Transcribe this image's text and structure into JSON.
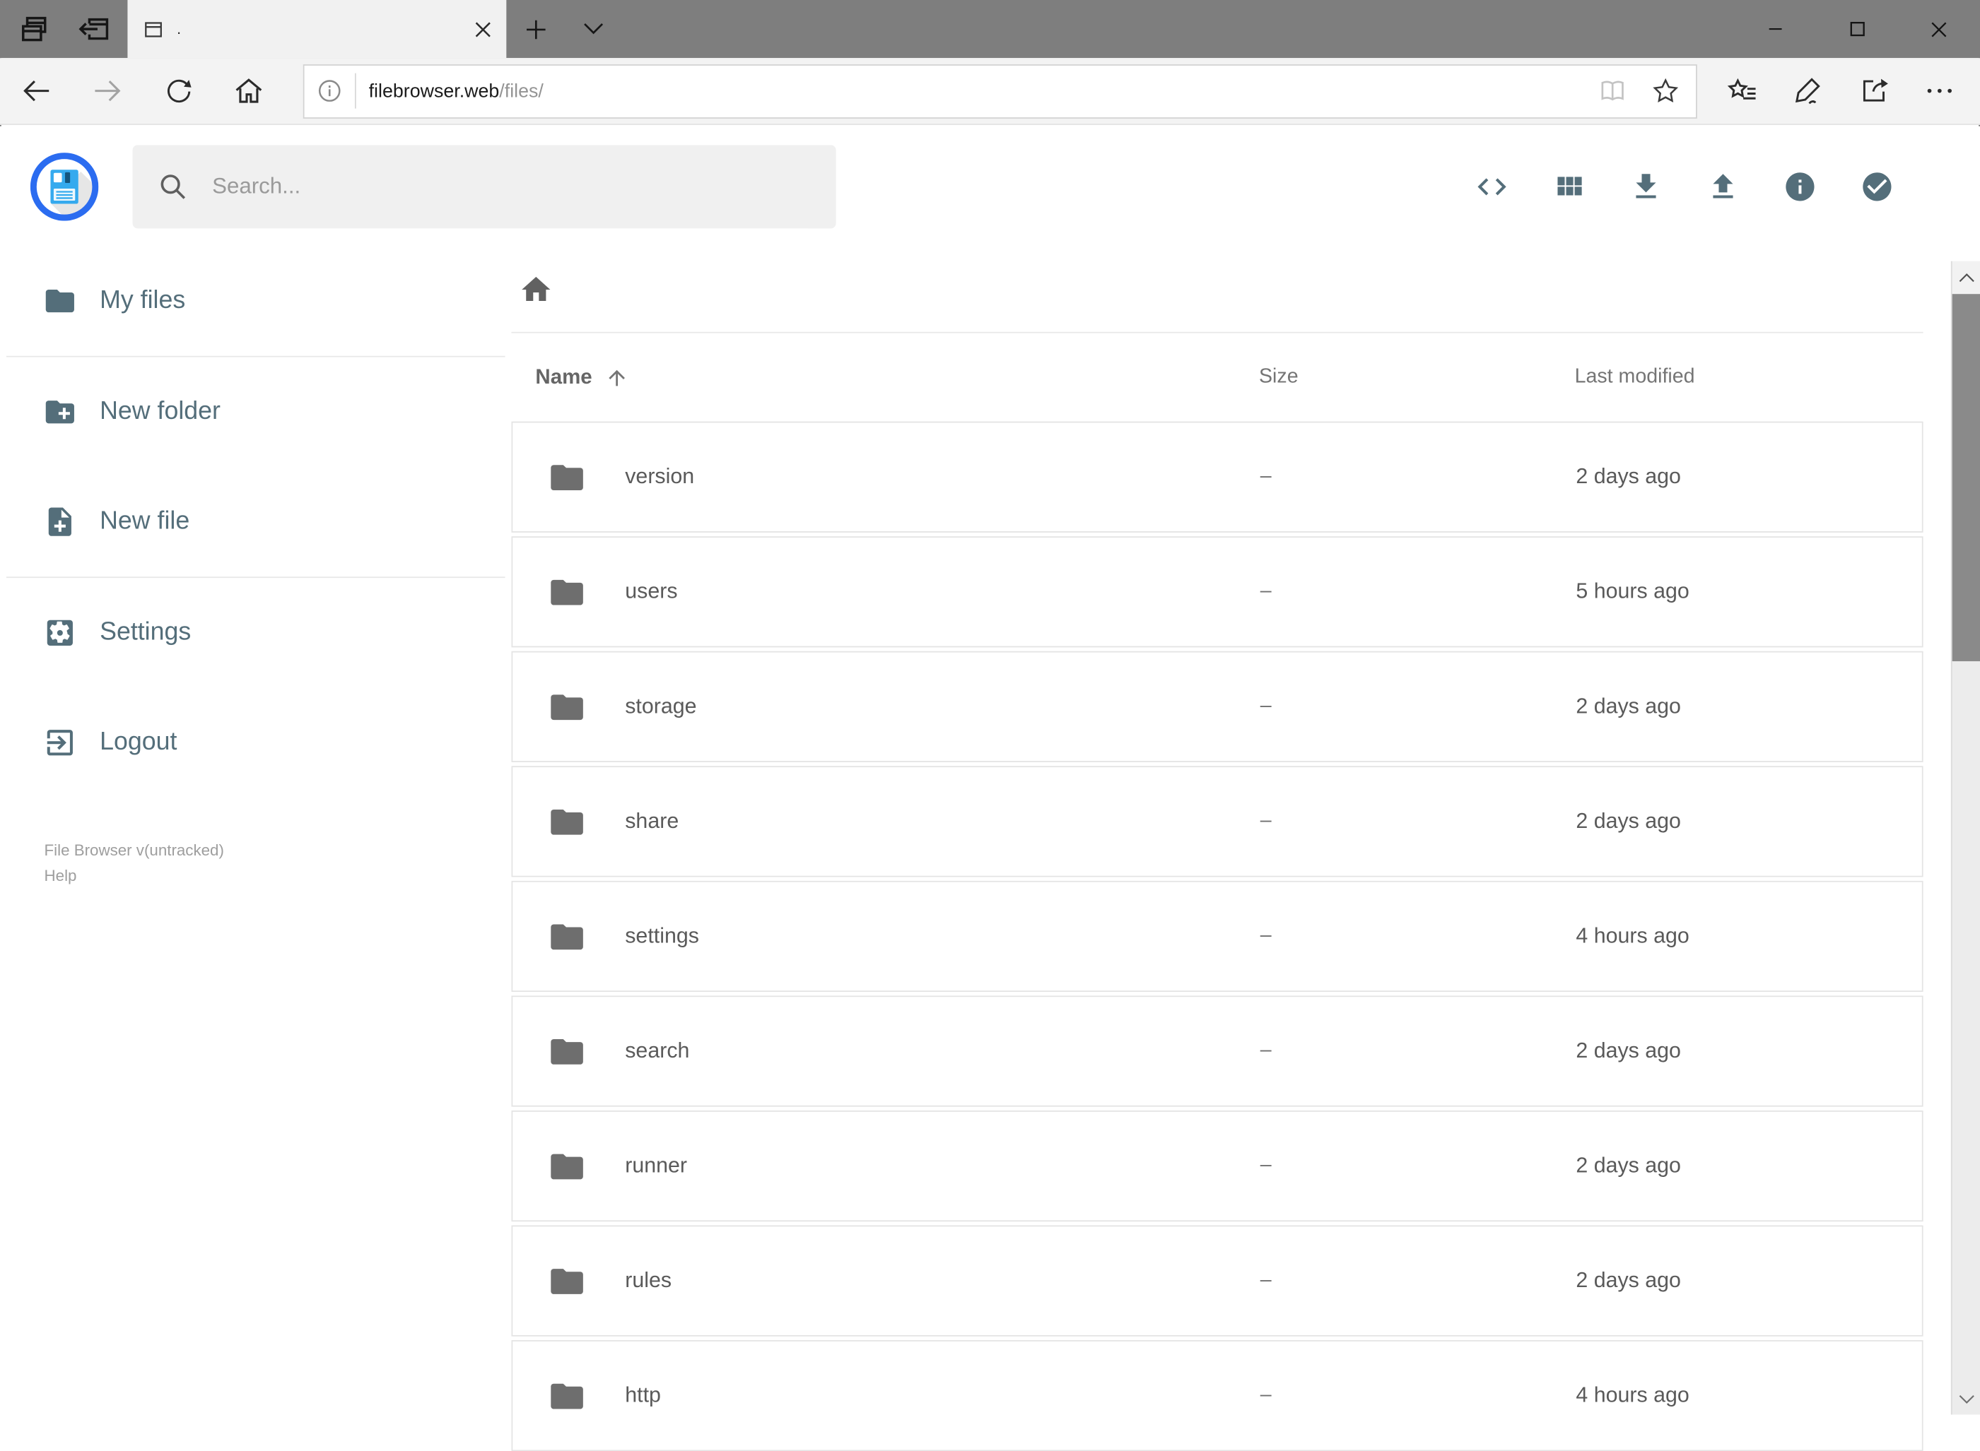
{
  "browser": {
    "tabbar": {
      "tab_title": ".",
      "left_icons": [
        "tab-preview",
        "set-tabs-aside"
      ],
      "window_controls": [
        "minimize",
        "maximize",
        "close"
      ]
    },
    "navbar": {
      "url_domain": "filebrowser.web",
      "url_path": "/files/",
      "icons": [
        "back",
        "forward",
        "refresh",
        "home",
        "site-info",
        "reading-view",
        "favorite-star",
        "hub",
        "web-notes",
        "share",
        "more"
      ]
    }
  },
  "app": {
    "header": {
      "search_placeholder": "Search...",
      "action_icons": [
        "code",
        "grid-view",
        "download",
        "upload",
        "info",
        "select-multiple"
      ]
    },
    "sidebar": {
      "items": [
        {
          "label": "My files",
          "icon": "folder"
        },
        {
          "label": "New folder",
          "icon": "folder-plus"
        },
        {
          "label": "New file",
          "icon": "file-plus"
        },
        {
          "label": "Settings",
          "icon": "settings-gear"
        },
        {
          "label": "Logout",
          "icon": "logout"
        }
      ],
      "footer": {
        "version": "File Browser v(untracked)",
        "help_label": "Help"
      }
    },
    "listing": {
      "breadcrumb_icons": [
        "home"
      ],
      "columns": {
        "name": "Name",
        "size": "Size",
        "modified": "Last modified"
      },
      "sort": {
        "column": "Name",
        "direction": "ascending"
      },
      "rows": [
        {
          "name": "version",
          "size": "–",
          "modified": "2 days ago",
          "type": "folder"
        },
        {
          "name": "users",
          "size": "–",
          "modified": "5 hours ago",
          "type": "folder"
        },
        {
          "name": "storage",
          "size": "–",
          "modified": "2 days ago",
          "type": "folder"
        },
        {
          "name": "share",
          "size": "–",
          "modified": "2 days ago",
          "type": "folder"
        },
        {
          "name": "settings",
          "size": "–",
          "modified": "4 hours ago",
          "type": "folder"
        },
        {
          "name": "search",
          "size": "–",
          "modified": "2 days ago",
          "type": "folder"
        },
        {
          "name": "runner",
          "size": "–",
          "modified": "2 days ago",
          "type": "folder"
        },
        {
          "name": "rules",
          "size": "–",
          "modified": "2 days ago",
          "type": "folder"
        },
        {
          "name": "http",
          "size": "–",
          "modified": "4 hours ago",
          "type": "folder"
        }
      ]
    }
  },
  "theme": {
    "accent_slate": "#546e7a",
    "row_icon_gray": "#6e6e6e",
    "logo_ring_blue": "#2b6cf0",
    "logo_disk_blue": "#35aaee",
    "tabbar_gray": "#7e7e7e"
  }
}
